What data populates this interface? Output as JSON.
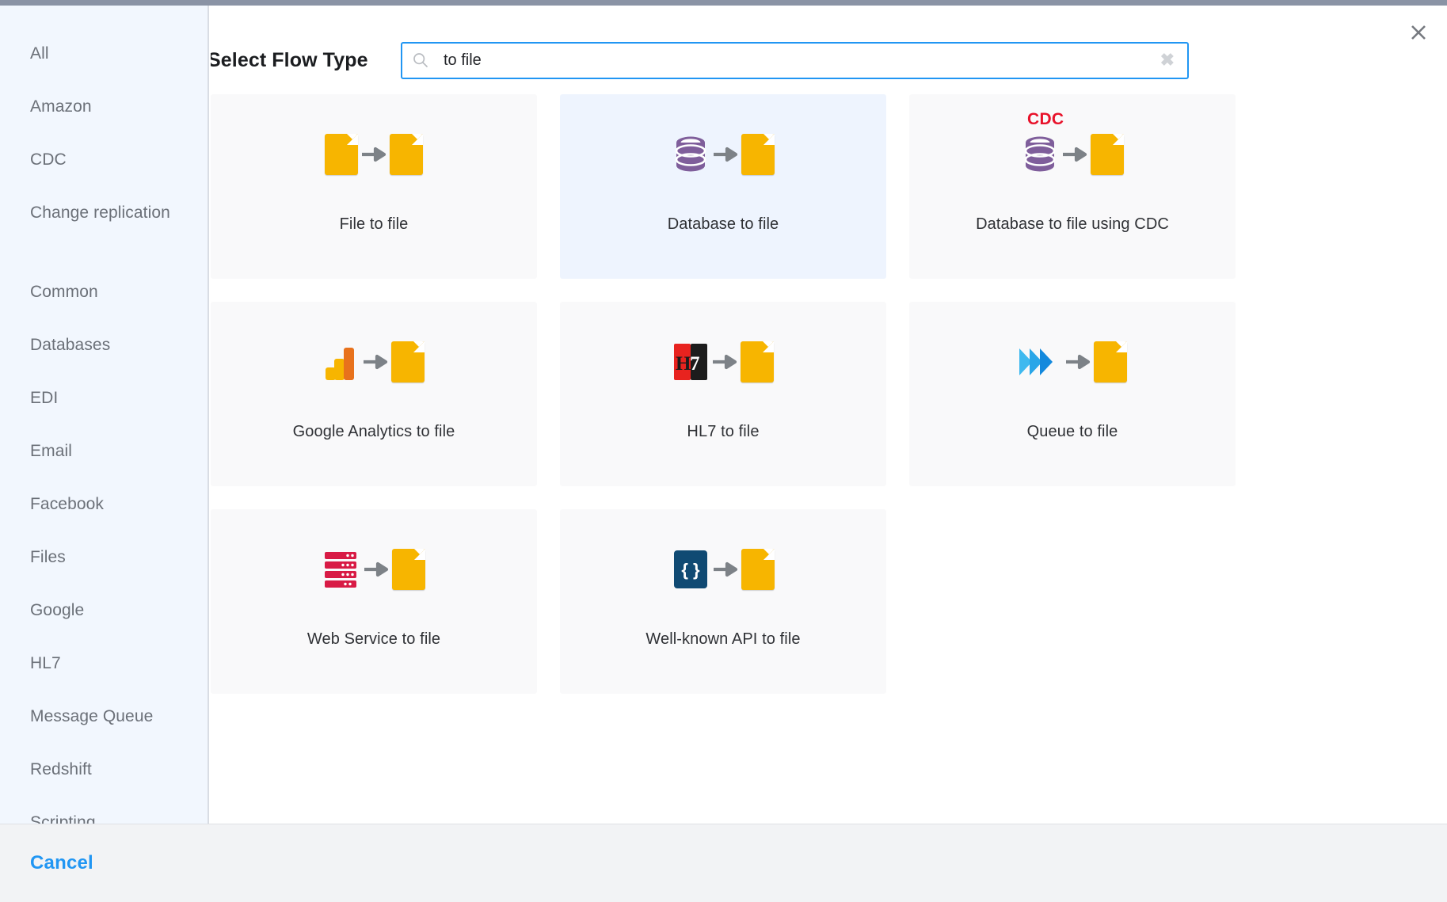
{
  "window": {
    "close_label": "×"
  },
  "sidebar": {
    "items": [
      {
        "label": "All"
      },
      {
        "label": "Amazon"
      },
      {
        "label": "CDC"
      },
      {
        "label": "Change replication"
      },
      {
        "label": "Common"
      },
      {
        "label": "Databases"
      },
      {
        "label": "EDI"
      },
      {
        "label": "Email"
      },
      {
        "label": "Facebook"
      },
      {
        "label": "Files"
      },
      {
        "label": "Google"
      },
      {
        "label": "HL7"
      },
      {
        "label": "Message Queue"
      },
      {
        "label": "Redshift"
      },
      {
        "label": "Scripting"
      }
    ]
  },
  "header": {
    "title": "Select Flow Type"
  },
  "search": {
    "value": "to file",
    "placeholder": "",
    "clear_label": "✖",
    "icon": "search-icon"
  },
  "tiles": [
    {
      "label": "File to file",
      "icon": "file-to-file-icon",
      "badge": "",
      "selected": false
    },
    {
      "label": "Database to file",
      "icon": "database-to-file-icon",
      "badge": "",
      "selected": true
    },
    {
      "label": "Database to file using CDC",
      "icon": "database-to-file-cdc-icon",
      "badge": "CDC",
      "selected": false
    },
    {
      "label": "Google Analytics to file",
      "icon": "google-analytics-to-file-icon",
      "badge": "",
      "selected": false
    },
    {
      "label": "HL7 to file",
      "icon": "hl7-to-file-icon",
      "badge": "",
      "selected": false
    },
    {
      "label": "Queue to file",
      "icon": "queue-to-file-icon",
      "badge": "",
      "selected": false
    },
    {
      "label": "Web Service to file",
      "icon": "web-service-to-file-icon",
      "badge": "",
      "selected": false
    },
    {
      "label": "Well-known API to file",
      "icon": "well-known-api-to-file-icon",
      "badge": "",
      "selected": false
    }
  ],
  "footer": {
    "cancel_label": "Cancel"
  },
  "colors": {
    "accent": "#2196f3",
    "sidebar_bg": "#f2f7fe",
    "tile_bg": "#f9f9fa",
    "tile_selected_bg": "#eef4fe",
    "doc_yellow": "#f7b500",
    "db_purple": "#7f5e9b",
    "cdc_red": "#e8122a",
    "api_navy": "#104a73",
    "server_red": "#d81b45",
    "queue_blue": "#1e9ae0"
  }
}
